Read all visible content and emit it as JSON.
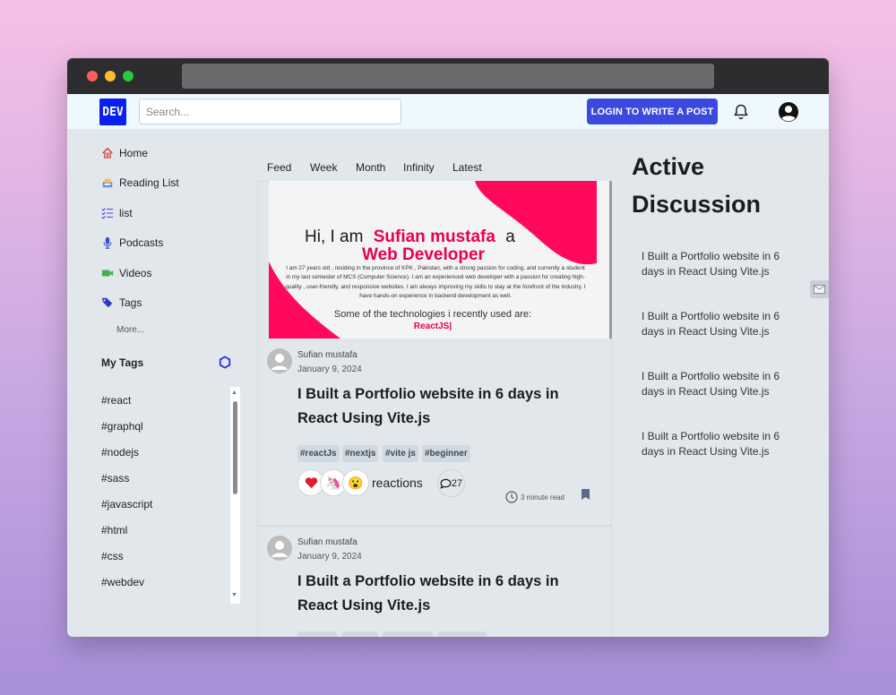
{
  "navbar": {
    "logo_text": "DEV",
    "search_placeholder": "Search...",
    "login_button": "LOGIN TO WRITE A POST",
    "bell_icon": "bell-icon",
    "account_icon": "account-circle-icon"
  },
  "sidebar": {
    "items": [
      {
        "label": "Home",
        "icon": "home-icon"
      },
      {
        "label": "Reading List",
        "icon": "reading-list-icon"
      },
      {
        "label": "list",
        "icon": "checklist-icon"
      },
      {
        "label": "Podcasts",
        "icon": "microphone-icon"
      },
      {
        "label": "Videos",
        "icon": "video-camera-icon"
      },
      {
        "label": "Tags",
        "icon": "tags-icon"
      }
    ],
    "more": "More...",
    "my_tags_title": "My Tags",
    "tags": [
      "#react",
      "#graphql",
      "#nodejs",
      "#sass",
      "#javascript",
      "#html",
      "#css",
      "#webdev"
    ]
  },
  "feed": {
    "tabs": [
      "Feed",
      "Week",
      "Month",
      "Infinity",
      "Latest"
    ],
    "banner": {
      "greeting": "Hi, I am",
      "name": "Sufian mustafa",
      "article": "a",
      "role": "Web Developer",
      "bio": "I am 27 years old , residing in the province of KPK , Pakistan, with a strong passion for coding, and currently a student in my last semester of MCS (Computer Science). I am an experienced web developer with a passion for creating high-quality , user-friendly, and responsive websites. I am always improving my skills to stay at the forefront of the industry. I have hands-on experience in backend development as well.",
      "tech_heading": "Some of the technologies i recently used are:",
      "tech_current": "ReactJS|"
    },
    "posts": [
      {
        "author": "Sufian mustafa",
        "date": "January 9, 2024",
        "title": "I Built a Portfolio website in 6 days in React Using Vite.js",
        "tags": [
          "#reactJs",
          "#nextjs",
          "#vite js",
          "#beginner"
        ],
        "reactions": [
          "❤️",
          "🦄",
          "😮"
        ],
        "reactions_label": "reactions",
        "comments": "27",
        "read_time": "3 minute read"
      },
      {
        "author": "Sufian mustafa",
        "date": "January 9, 2024",
        "title": "I Built a Portfolio website in 6 days in React Using Vite.js"
      }
    ]
  },
  "active_discussion": {
    "title": "Active Discussion",
    "items": [
      "I Built a Portfolio website in 6 days in React Using Vite.js",
      "I Built a Portfolio website in 6 days in React Using Vite.js",
      "I Built a Portfolio website in 6 days in React Using Vite.js",
      "I Built a Portfolio website in 6 days in React Using Vite.js"
    ]
  },
  "colors": {
    "brand_blue": "#3b49df",
    "logo_blue": "#0a1ff0",
    "banner_pink": "#ff0a5a",
    "page_bg": "#e2e7ec"
  }
}
